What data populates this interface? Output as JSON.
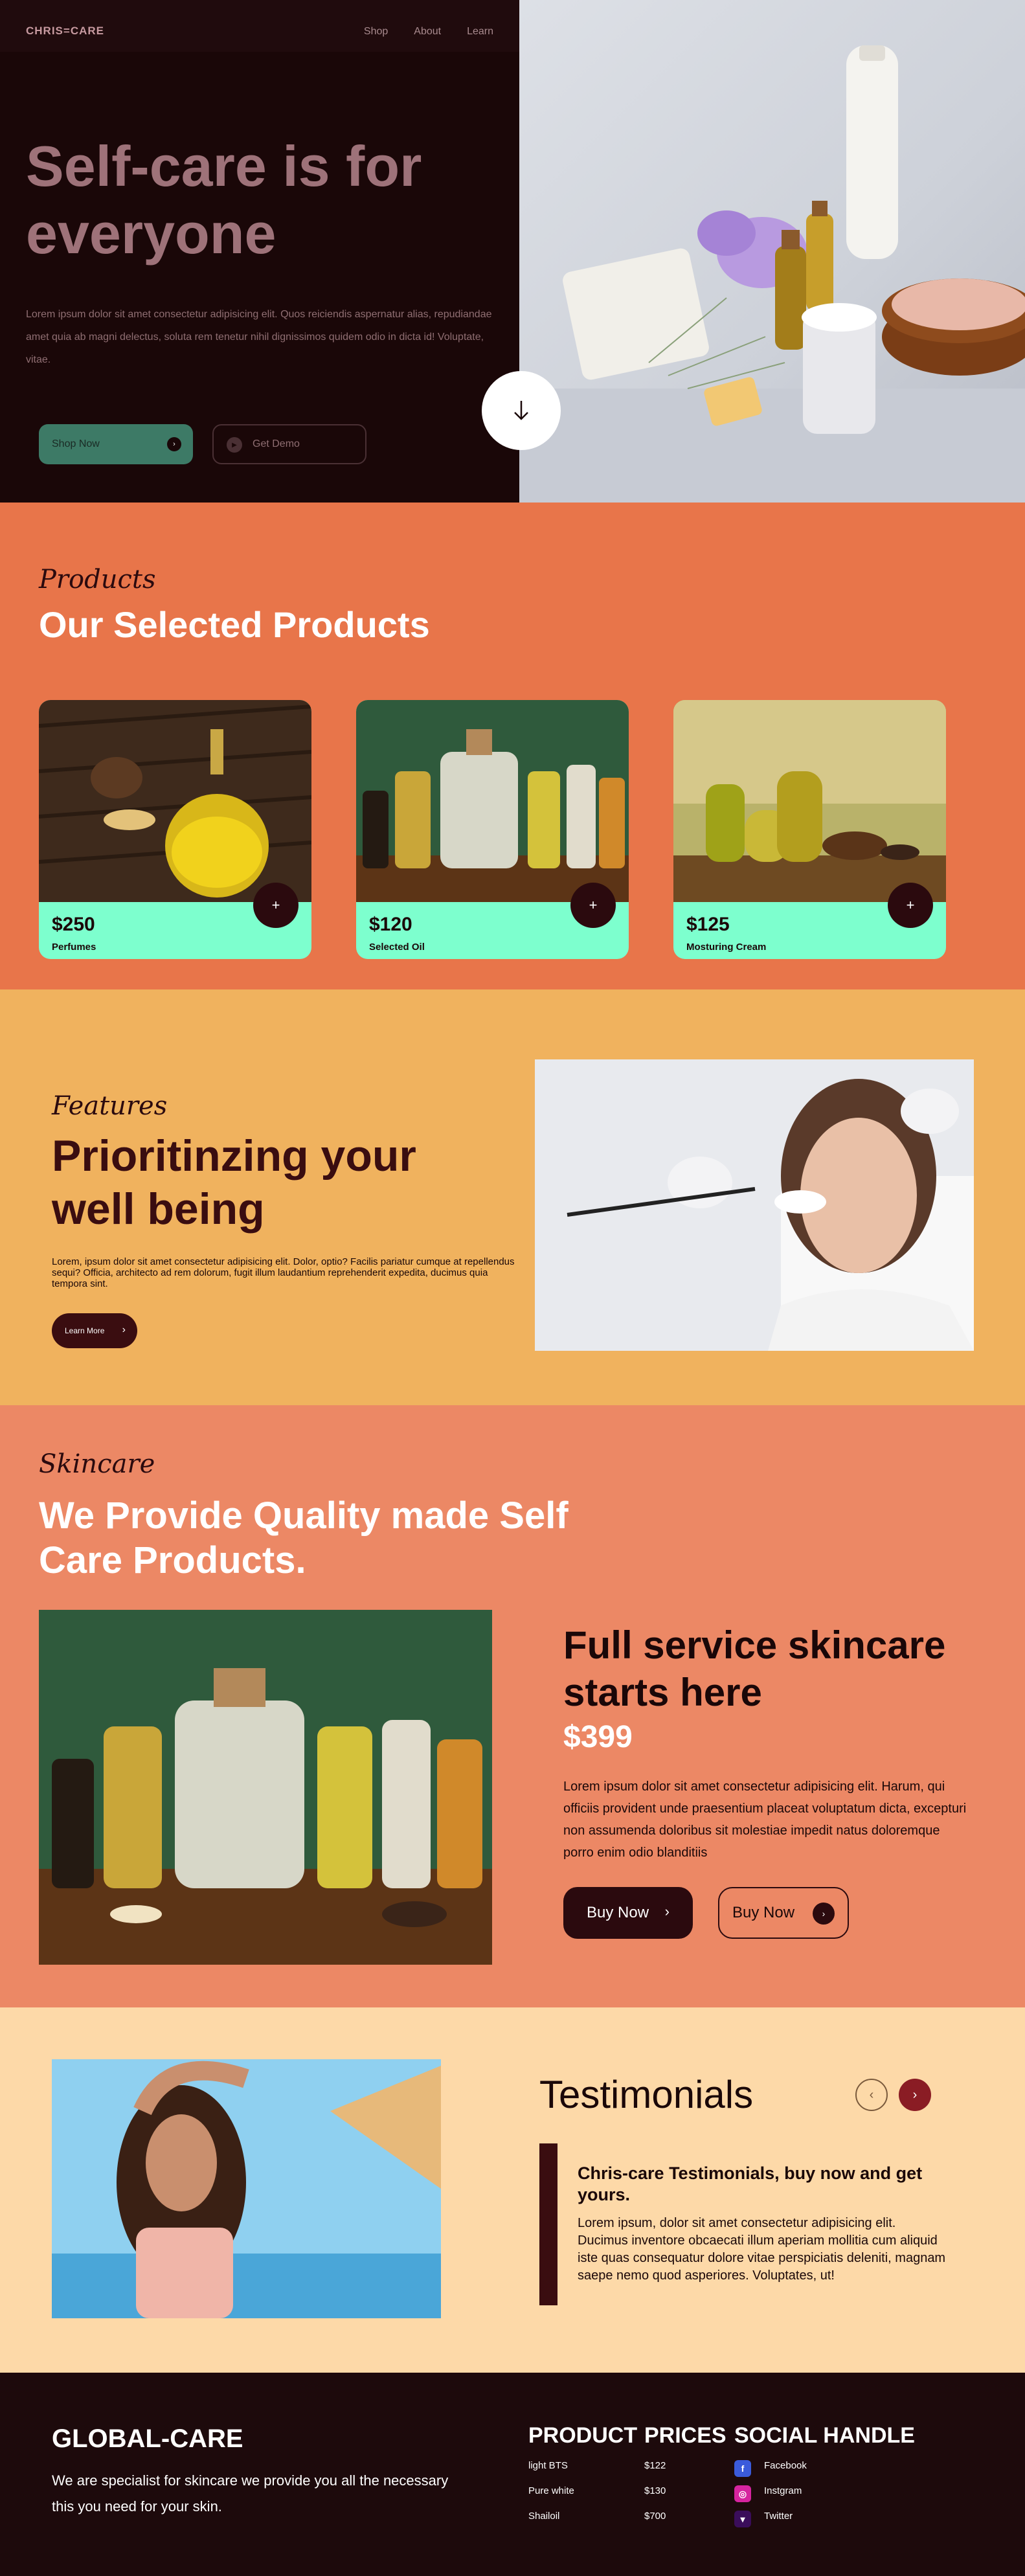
{
  "brand": {
    "logo": "CHRIS=CARE"
  },
  "nav": {
    "items": [
      "Shop",
      "About",
      "Learn"
    ]
  },
  "hero": {
    "title": "Self-care is for everyone",
    "text": "Lorem ipsum dolor sit amet consectetur adipisicing elit. Quos reiciendis aspernatur alias, repudiandae amet quia ab magni delectus, soluta rem tenetur nihil dignissimos quidem odio in dicta id! Voluptate, vitae.",
    "shop_label": "Shop Now",
    "demo_label": "Get Demo"
  },
  "products": {
    "script_label": "Products",
    "title": "Our Selected Products",
    "items": [
      {
        "price": "$250",
        "name": "Perfumes"
      },
      {
        "price": "$120",
        "name": "Selected Oil"
      },
      {
        "price": "$125",
        "name": "Mosturing Cream"
      }
    ]
  },
  "features": {
    "script_label": "Features",
    "title": "Prioritinzing your well being",
    "text": "Lorem, ipsum dolor sit amet consectetur adipisicing elit. Dolor, optio? Facilis pariatur cumque at repellendus sequi? Officia, architecto ad rem dolorum, fugit illum laudantium reprehenderit expedita, ducimus quia tempora sint.",
    "button_label": "Learn More"
  },
  "skincare": {
    "script_label": "Skincare",
    "title": "We Provide Quality made Self Care Products.",
    "heading": "Full service skincare starts here",
    "price": "$399",
    "text": "Lorem ipsum dolor sit amet consectetur adipisicing elit. Harum, qui officiis provident unde praesentium placeat voluptatum dicta, excepturi non assumenda doloribus sit molestiae impedit natus doloremque porro enim odio blanditiis",
    "buy1_label": "Buy Now",
    "buy2_label": "Buy Now"
  },
  "testimonials": {
    "title": "Testimonials",
    "heading": "Chris-care Testimonials, buy now and get yours.",
    "text": "Lorem ipsum, dolor sit amet consectetur adipisicing elit. Ducimus inventore obcaecati illum aperiam mollitia cum aliquid iste quas consequatur dolore vitae perspiciatis deleniti, magnam saepe nemo quod asperiores. Voluptates, ut!"
  },
  "footer": {
    "title": "GLOBAL-CARE",
    "tagline": "We are specialist for skincare we provide you all the necessary this you need for your skin.",
    "product_header": "PRODUCT",
    "prices_header": "PRICES",
    "social_header": "SOCIAL HANDLE",
    "products": [
      "light BTS",
      "Pure white",
      "Shailoil"
    ],
    "prices": [
      "$122",
      "$130",
      "$700"
    ],
    "socials": [
      {
        "label": "Facebook",
        "icon": "facebook-icon",
        "color": "#3b5bdb"
      },
      {
        "label": "Instgram",
        "icon": "instagram-icon",
        "color": "#d6249f"
      },
      {
        "label": "Twitter",
        "icon": "twitter-icon",
        "color": "#3a0d5a"
      }
    ]
  },
  "colors": {
    "hero_dark": "#1a0708",
    "products_bg": "#e8754a",
    "card_bg": "#7dffce",
    "features_bg": "#f0b25e",
    "skincare_bg": "#ec8865",
    "testimonials_bg": "#fdd9a8",
    "footer_bg": "#1d0a0c",
    "accent_dark": "#3a0d10"
  }
}
